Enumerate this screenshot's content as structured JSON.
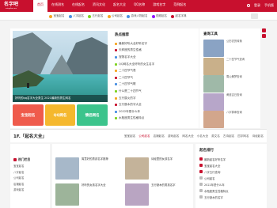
{
  "header": {
    "logo_text": "名字吧",
    "logo_sub": "mingziba.com",
    "nav": [
      "首页",
      "在线测名",
      "在线起名",
      "资讯文化",
      "起名大全",
      "QQ名称",
      "游戏名字",
      "范例起名",
      "宝宝取名",
      "专家问答"
    ],
    "login_label": "登录",
    "mobile_label": "手机版"
  },
  "subnav": [
    {
      "label": "宝宝起名",
      "color": "#f5a623"
    },
    {
      "label": "八字起名",
      "color": "#4a90e2"
    },
    {
      "label": "五行起名",
      "color": "#7ed321"
    },
    {
      "label": "公司起名",
      "color": "#f5a623"
    },
    {
      "label": "游戏人物起名",
      "color": "#4a90e2"
    },
    {
      "label": "视频起名",
      "color": "#9013fe"
    },
    {
      "label": "起名字典",
      "color": "#c8102e"
    }
  ],
  "slider": {
    "caption": "好听的qq名字大全男生 2021最新的男生网名"
  },
  "promos": [
    {
      "label": "宝宝起名",
      "color": "#ef5b4c"
    },
    {
      "label": "QQ网名",
      "color": "#f5b82e"
    },
    {
      "label": "情侣网名",
      "color": "#3cc48c"
    }
  ],
  "hot": {
    "title": "热点推荐",
    "items": [
      {
        "text": "最新好听大全好听名字",
        "color": "#f5a623"
      },
      {
        "text": "天秤座的男生性格",
        "color": "#c8102e"
      },
      {
        "text": "宠物名字大全",
        "color": "#4a90e2"
      },
      {
        "text": "QQ网名大全好听的女生名字",
        "color": "#7ed321"
      },
      {
        "text": "二十四节气表",
        "color": "#f5a623"
      },
      {
        "text": "二十四节气",
        "color": "#c8102e"
      },
      {
        "text": "二十四节气歌",
        "color": "#4a90e2"
      },
      {
        "text": "什么是二十四节气",
        "color": "#7ed321"
      },
      {
        "text": "五行属火的字",
        "color": "#f5a623"
      },
      {
        "text": "五行属木的字大全",
        "color": "#c8102e"
      },
      {
        "text": "2022年是什么年",
        "color": "#4a90e2"
      },
      {
        "text": "水瓶座男生性格特点",
        "color": "#7ed321"
      }
    ]
  },
  "tools": {
    "title": "查询工具",
    "items": [
      {
        "text": "公历农历转换",
        "color": "#8aa3c4"
      },
      {
        "text": "二十四节气查询",
        "color": "#c9b08a"
      },
      {
        "text": "周公解梦查询",
        "color": "#9fb9a8"
      },
      {
        "text": "黄道吉日查询",
        "color": "#b7a6c9"
      },
      {
        "text": "八字算命查询",
        "color": "#d2a68c"
      }
    ]
  },
  "section": {
    "title": "1F.「起名大全」",
    "tabs": [
      "宝宝起名",
      "公司起名",
      "店铺起名",
      "游戏起名",
      "网名大全",
      "小名大全",
      "英文名",
      "古诗起名",
      "四字网名",
      "诗经起名"
    ]
  },
  "leftcol": {
    "head": "热门栏目",
    "items": [
      "宝宝起名",
      "八字起名",
      "公司起名",
      "店铺起名",
      "游戏起名"
    ]
  },
  "cards": [
    {
      "text": "寓意好的男孩名字推荐",
      "color": "#a7b8c9"
    },
    {
      "text": "诗经里的女孩名字",
      "color": "#c4b39a"
    },
    {
      "text": "好听的女孩名字大全",
      "color": "#9db49a"
    },
    {
      "text": "五行缺木的男孩名字",
      "color": "#b9a5c2"
    }
  ],
  "rank": {
    "title": "起名排行",
    "items": [
      "最新起名好听名字",
      "宝宝起名大全",
      "八字五行查询",
      "公司起名",
      "2022年是什么年",
      "水瓶座男生性格特点",
      "五行缺水的名字"
    ]
  }
}
